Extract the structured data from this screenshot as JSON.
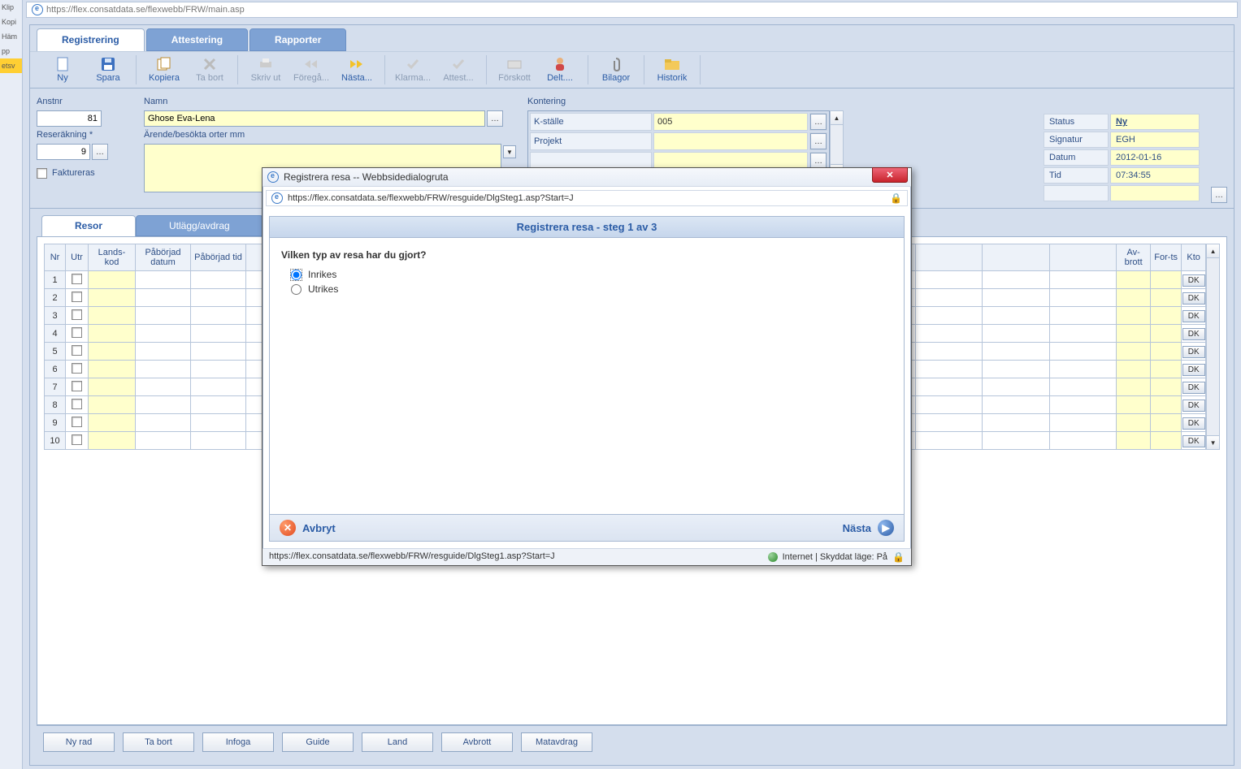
{
  "url_top": "https://flex.consatdata.se/flexwebb/FRW/main.asp",
  "leftnav": [
    "Klip",
    "Kopi",
    "Häm",
    "pp",
    "etsv"
  ],
  "tabs": {
    "active": "Registrering",
    "others": [
      "Attestering",
      "Rapporter"
    ]
  },
  "toolbar": [
    {
      "label": "Ny",
      "icon": "new",
      "enabled": true
    },
    {
      "label": "Spara",
      "icon": "save",
      "enabled": true
    }
  ],
  "toolbar2": [
    {
      "label": "Kopiera",
      "icon": "copy",
      "enabled": true
    },
    {
      "label": "Ta bort",
      "icon": "del",
      "enabled": false
    }
  ],
  "toolbar3": [
    {
      "label": "Skriv ut",
      "icon": "print",
      "enabled": false
    },
    {
      "label": "Föregå...",
      "icon": "prev",
      "enabled": false
    },
    {
      "label": "Nästa...",
      "icon": "next",
      "enabled": true
    }
  ],
  "toolbar4": [
    {
      "label": "Klarma...",
      "icon": "ok",
      "enabled": false
    },
    {
      "label": "Attest...",
      "icon": "att",
      "enabled": false
    }
  ],
  "toolbar5": [
    {
      "label": "Förskott",
      "icon": "fors",
      "enabled": false
    },
    {
      "label": "Delt....",
      "icon": "delt",
      "enabled": true
    }
  ],
  "toolbar6": [
    {
      "label": "Bilagor",
      "icon": "att2",
      "enabled": true
    }
  ],
  "toolbar7": [
    {
      "label": "Historik",
      "icon": "hist",
      "enabled": true
    }
  ],
  "form": {
    "anstnr_label": "Anstnr",
    "anstnr": "81",
    "reserakning_label": "Reseräkning *",
    "reserakning": "9",
    "faktureras_label": "Faktureras",
    "namn_label": "Namn",
    "namn": "Ghose Eva-Lena",
    "arende_label": "Ärende/besökta orter mm",
    "arende": ""
  },
  "kontering_label": "Kontering",
  "kontering": [
    {
      "label": "K-ställe",
      "value": "005"
    },
    {
      "label": "Projekt",
      "value": ""
    },
    {
      "label": "",
      "value": ""
    },
    {
      "label": "",
      "value": ""
    }
  ],
  "status": {
    "Status": "Ny",
    "Signatur": "EGH",
    "Datum": "2012-01-16",
    "Tid": "07:34:55",
    "extra": ""
  },
  "subtabs": {
    "active": "Resor",
    "other": "Utlägg/avdrag"
  },
  "grid_cols": [
    "Nr",
    "Utr",
    "Lands-kod",
    "Påbörjad datum",
    "Påbörjad tid",
    "",
    "",
    "",
    "",
    "",
    "",
    "",
    "",
    "",
    "",
    "",
    "",
    "",
    "Av-brott",
    "For-ts",
    "Kto"
  ],
  "grid_rows": [
    1,
    2,
    3,
    4,
    5,
    6,
    7,
    8,
    9,
    10
  ],
  "dk": "DK",
  "bottom_buttons": [
    "Ny rad",
    "Ta bort",
    "Infoga",
    "Guide",
    "Land",
    "Avbrott",
    "Matavdrag"
  ],
  "dialog": {
    "title": "Registrera resa -- Webbsidedialogruta",
    "url": "https://flex.consatdata.se/flexwebb/FRW/resguide/DlgSteg1.asp?Start=J",
    "panel_title": "Registrera resa - steg 1 av 3",
    "question": "Vilken typ av resa har du gjort?",
    "opt1": "Inrikes",
    "opt2": "Utrikes",
    "cancel": "Avbryt",
    "next": "Nästa",
    "status_url": "https://flex.consatdata.se/flexwebb/FRW/resguide/DlgSteg1.asp?Start=J",
    "status_zone": "Internet | Skyddat läge: På"
  }
}
